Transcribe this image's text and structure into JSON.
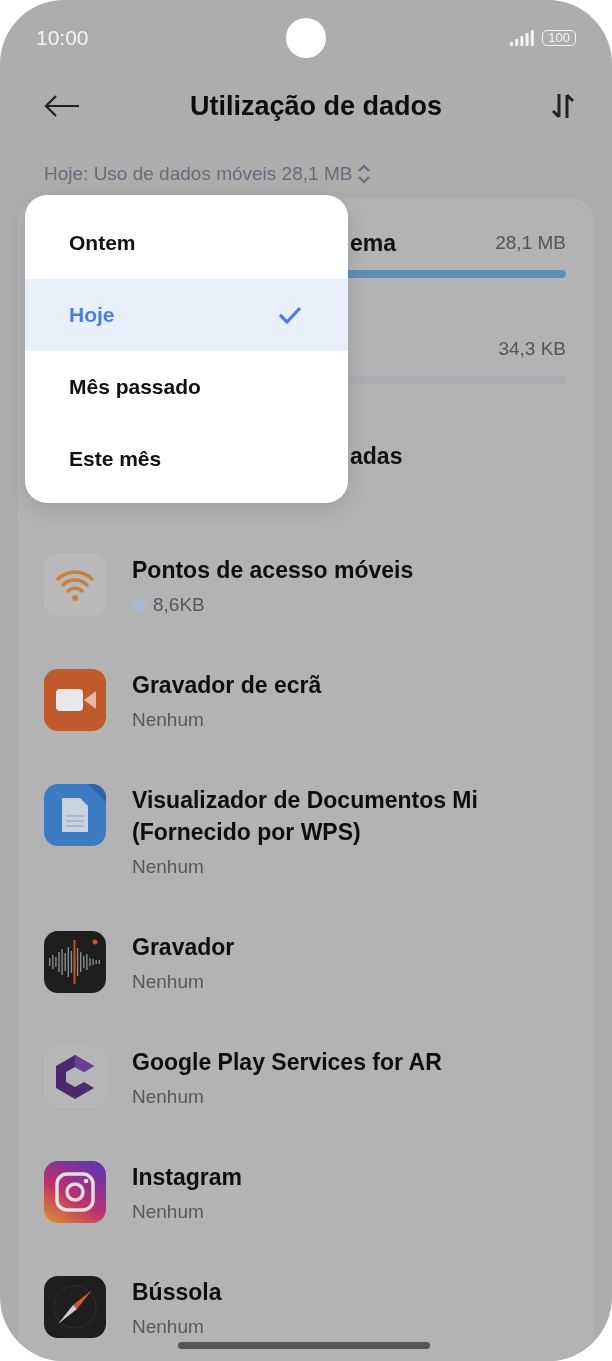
{
  "status_bar": {
    "time": "10:00",
    "battery": "100"
  },
  "header": {
    "title": "Utilização de dados"
  },
  "period_selector": {
    "label": "Hoje: Uso de dados móveis 28,1 MB"
  },
  "summary": [
    {
      "label": "ema",
      "value": "28,1 MB",
      "level": 1
    },
    {
      "value": "34,3 KB"
    }
  ],
  "section_title": "adas",
  "apps": [
    {
      "kind": "hotspot",
      "name": "Pontos de acesso móveis",
      "usage": "8,6KB",
      "color": "#a9b8d0"
    },
    {
      "kind": "screen-recorder",
      "name": "Gravador de ecrã",
      "usage": "Nenhum"
    },
    {
      "kind": "documents",
      "name": "Visualizador de Documentos Mi (Fornecido por WPS)",
      "usage": "Nenhum"
    },
    {
      "kind": "recorder",
      "name": "Gravador",
      "usage": "Nenhum"
    },
    {
      "kind": "ar",
      "name": "Google Play Services for AR",
      "usage": "Nenhum"
    },
    {
      "kind": "instagram",
      "name": "Instagram",
      "usage": "Nenhum"
    },
    {
      "kind": "compass",
      "name": "Bússola",
      "usage": "Nenhum"
    }
  ],
  "period_menu": {
    "items": [
      {
        "label": "Ontem",
        "selected": false
      },
      {
        "label": "Hoje",
        "selected": true
      },
      {
        "label": "Mês passado",
        "selected": false
      },
      {
        "label": "Este mês",
        "selected": false
      }
    ]
  }
}
